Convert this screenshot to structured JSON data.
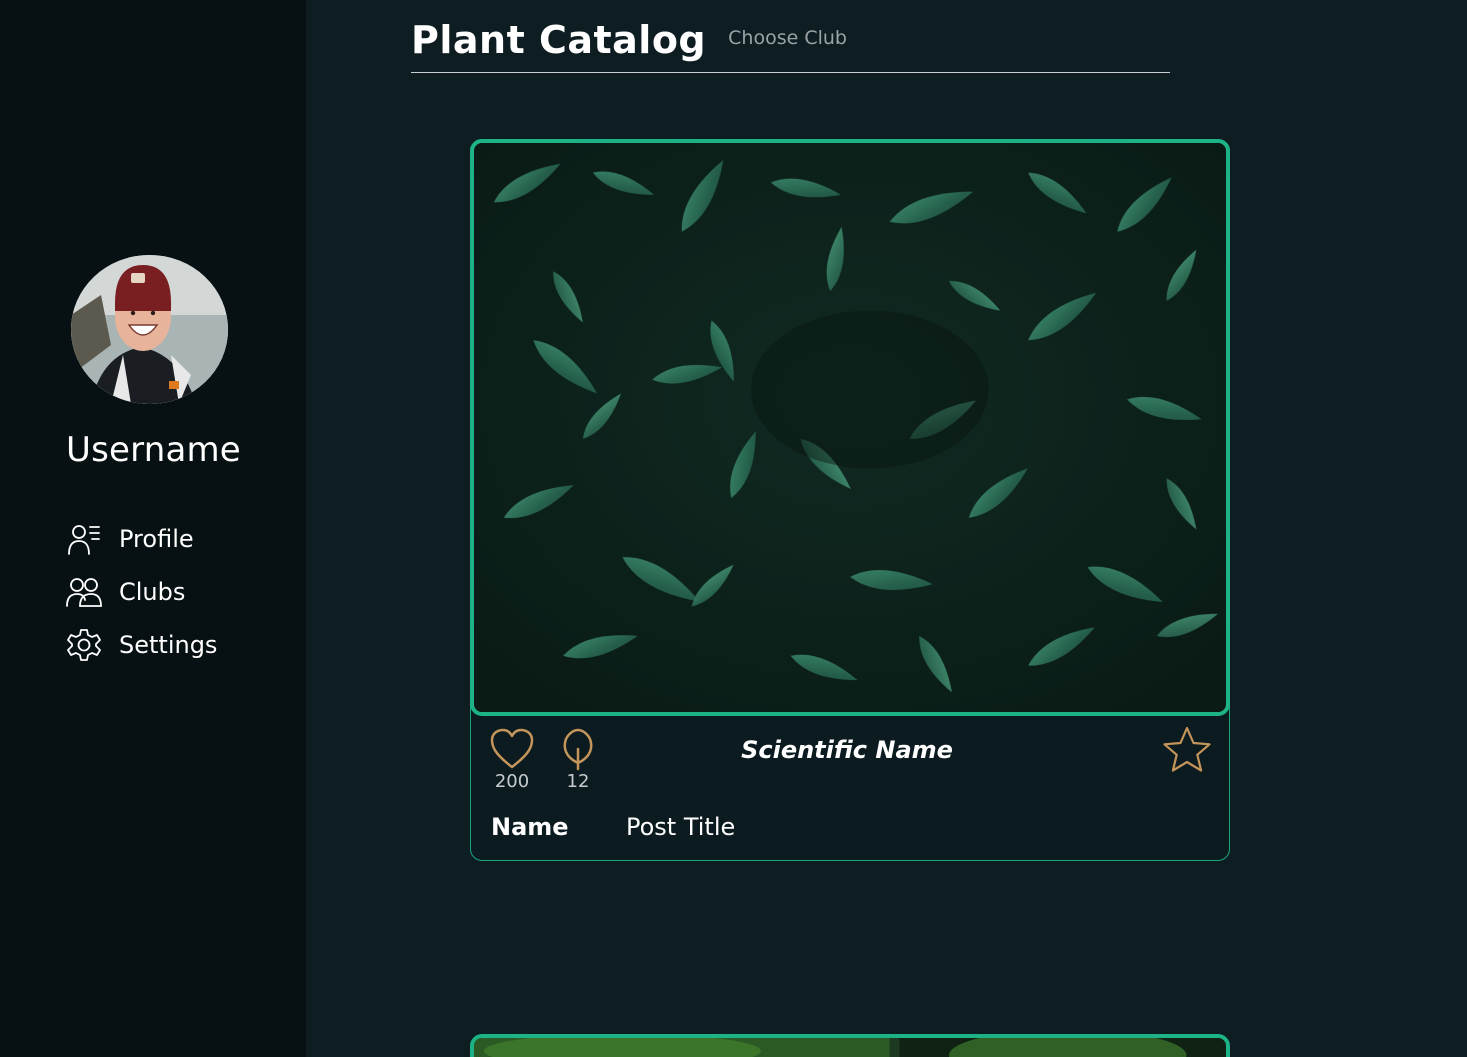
{
  "sidebar": {
    "username": "Username",
    "nav": [
      {
        "label": "Profile",
        "icon": "profile-icon"
      },
      {
        "label": "Clubs",
        "icon": "clubs-icon"
      },
      {
        "label": "Settings",
        "icon": "gear-icon"
      }
    ]
  },
  "header": {
    "title": "Plant Catalog",
    "club_select": "Choose Club"
  },
  "posts": [
    {
      "likes": "200",
      "comments": "12",
      "scientific_name": "Scientific Name",
      "author_name": "Name",
      "post_title": "Post Title"
    }
  ],
  "colors": {
    "background": "#0d1d22",
    "sidebar": "#071013",
    "accent": "#1db386",
    "icon_gold": "#c4955a"
  }
}
